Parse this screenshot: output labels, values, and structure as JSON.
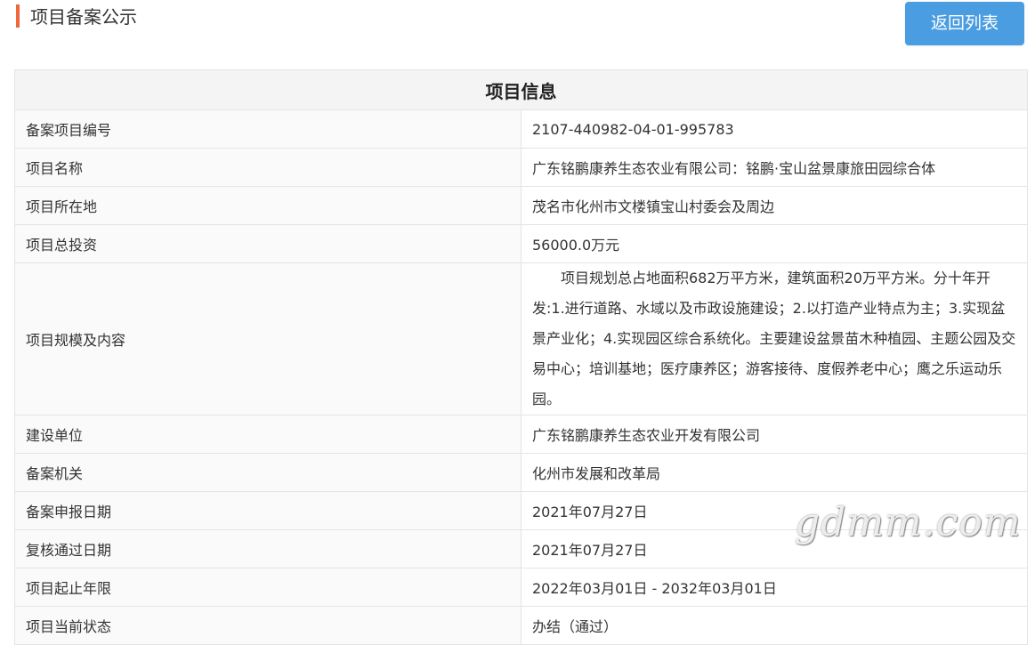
{
  "header": {
    "title": "项目备案公示",
    "back_button_label": "返回列表"
  },
  "table": {
    "caption": "项目信息",
    "rows": [
      {
        "label": "备案项目编号",
        "value": "2107-440982-04-01-995783"
      },
      {
        "label": "项目名称",
        "value": "广东铭鹏康养生态农业有限公司：铭鹏·宝山盆景康旅田园综合体"
      },
      {
        "label": "项目所在地",
        "value": "茂名市化州市文楼镇宝山村委会及周边"
      },
      {
        "label": "项目总投资",
        "value": "56000.0万元"
      },
      {
        "label": "项目规模及内容",
        "value": "项目规划总占地面积682万平方米，建筑面积20万平方米。分十年开发:1.进行道路、水域以及市政设施建设；2.以打造产业特点为主；3.实现盆景产业化；4.实现园区综合系统化。主要建设盆景苗木种植园、主题公园及交易中心；培训基地；医疗康养区；游客接待、度假养老中心；鹰之乐运动乐园。"
      },
      {
        "label": "建设单位",
        "value": "广东铭鹏康养生态农业开发有限公司"
      },
      {
        "label": "备案机关",
        "value": "化州市发展和改革局"
      },
      {
        "label": "备案申报日期",
        "value": "2021年07月27日"
      },
      {
        "label": "复核通过日期",
        "value": "2021年07月27日"
      },
      {
        "label": "项目起止年限",
        "value": "2022年03月01日 - 2032年03月01日"
      },
      {
        "label": "项目当前状态",
        "value": "办结（通过）"
      }
    ]
  },
  "watermark": "gdmm.com",
  "colors": {
    "accent_bar": "#f0663d",
    "button_bg": "#4a9de0",
    "border": "#e4e4e4",
    "caption_bg": "#f4f4f4"
  }
}
